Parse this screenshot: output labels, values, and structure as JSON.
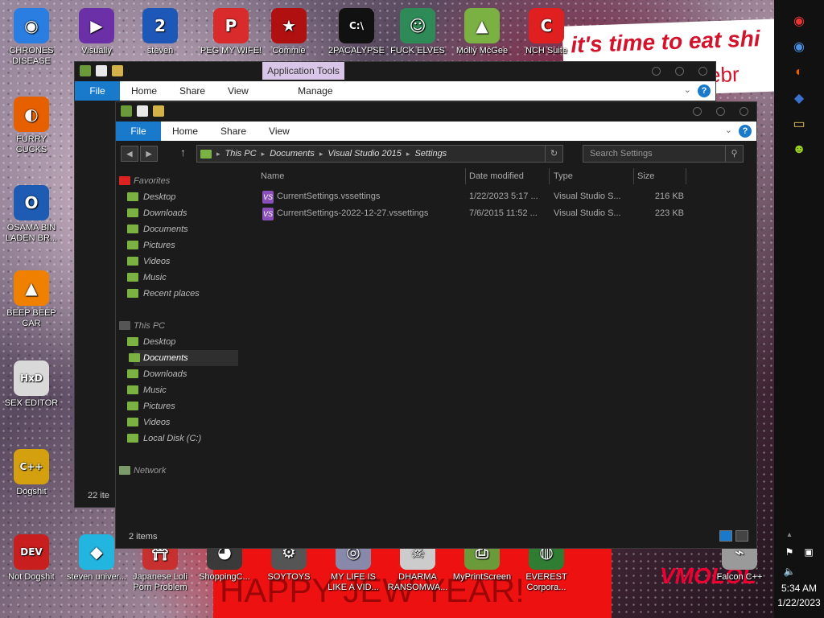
{
  "wallpaper": {
    "banner_line1": "it's time to eat shi",
    "banner_line2": "elebr",
    "bottom_text": "HAPPY JEW YEAR!",
    "vmo_text": "VMOLOL"
  },
  "desktop_icons": [
    {
      "label": "CHRONES DISEASE",
      "icon": "chrome-icon",
      "color": "#2a7de1",
      "glyph": "◉"
    },
    {
      "label": "Visually",
      "icon": "visual-studio-icon",
      "color": "#6b2fa8",
      "glyph": "▶"
    },
    {
      "label": "steven",
      "icon": "steven-icon",
      "color": "#1d57b8",
      "glyph": "2"
    },
    {
      "label": "PEG MY WIFE!",
      "icon": "peg-icon",
      "color": "#d92b2b",
      "glyph": "P"
    },
    {
      "label": "Commie",
      "icon": "commie-icon",
      "color": "#b01010",
      "glyph": "★"
    },
    {
      "label": "2PACALYPSE",
      "icon": "cmd-icon",
      "color": "#111111",
      "glyph": "C:\\"
    },
    {
      "label": "FUCK ELVES",
      "icon": "elf-icon",
      "color": "#2e8b57",
      "glyph": "☺"
    },
    {
      "label": "Molly McGee",
      "icon": "folder-icon",
      "color": "#7bb043",
      "glyph": "▲"
    },
    {
      "label": "NCH Suite",
      "icon": "nch-icon",
      "color": "#e02020",
      "glyph": "C"
    },
    {
      "label": "FURRY CUCKS",
      "icon": "firefox-icon",
      "color": "#e66000",
      "glyph": "◐"
    },
    {
      "label": "OSAMA BIN LADEN BR...",
      "icon": "obama-logo-icon",
      "color": "#1e5cb3",
      "glyph": "O"
    },
    {
      "label": "BEEP BEEP CAR",
      "icon": "vlc-icon",
      "color": "#f08000",
      "glyph": "▲"
    },
    {
      "label": "SEX EDITOR",
      "icon": "hxd-icon",
      "color": "#d9d9d9",
      "glyph": "HxD"
    },
    {
      "label": "Dogshit",
      "icon": "dogshit-icon",
      "color": "#d4a010",
      "glyph": "C++"
    },
    {
      "label": "Not Dogshit",
      "icon": "devcpp-icon",
      "color": "#c81e1e",
      "glyph": "DEV"
    },
    {
      "label": "steven univer...",
      "icon": "diamond-icon",
      "color": "#22b5e0",
      "glyph": "◆"
    },
    {
      "label": "Japanese Loli Porn Problem",
      "icon": "japanese-icon",
      "color": "#c83030",
      "glyph": "⛩"
    },
    {
      "label": "ShoppingC...",
      "icon": "shopping-icon",
      "color": "#3a3a3a",
      "glyph": "◕"
    },
    {
      "label": "SOYTOYS",
      "icon": "soytoys-icon",
      "color": "#555555",
      "glyph": "⚙"
    },
    {
      "label": "MY LIFE IS LIKE A VID...",
      "icon": "game-icon",
      "color": "#8888aa",
      "glyph": "◎"
    },
    {
      "label": "DHARMA RANSOMWA...",
      "icon": "skull-icon",
      "color": "#cccccc",
      "glyph": "☠"
    },
    {
      "label": "MyPrintScreen",
      "icon": "printscreen-icon",
      "color": "#6a9a3a",
      "glyph": "⎙"
    },
    {
      "label": "EVEREST Corpora...",
      "icon": "everest-icon",
      "color": "#2e7d32",
      "glyph": "◍"
    },
    {
      "label": "Falcon C++",
      "icon": "falcon-icon",
      "color": "#9a9a9a",
      "glyph": "⌁"
    }
  ],
  "taskbar": {
    "time": "5:34 AM",
    "date": "1/22/2023",
    "pinned": [
      {
        "name": "chrome-colorful-icon",
        "glyph": "◉",
        "color": "#e33"
      },
      {
        "name": "chrome-icon",
        "glyph": "◉",
        "color": "#4a90e2"
      },
      {
        "name": "firefox-icon",
        "glyph": "◐",
        "color": "#e66000"
      },
      {
        "name": "app-icon",
        "glyph": "◆",
        "color": "#3a70d0"
      },
      {
        "name": "explorer-icon",
        "glyph": "▭",
        "color": "#e0c060"
      },
      {
        "name": "game-icon",
        "glyph": "☻",
        "color": "#9ad020"
      }
    ]
  },
  "back_window": {
    "context_tab": "Application Tools",
    "tabs": [
      "File",
      "Home",
      "Share",
      "View",
      "Manage"
    ],
    "status": "22 ite"
  },
  "explorer": {
    "tabs": [
      "File",
      "Home",
      "Share",
      "View"
    ],
    "breadcrumb": [
      "This PC",
      "Documents",
      "Visual Studio 2015",
      "Settings"
    ],
    "search_placeholder": "Search Settings",
    "nav": {
      "favorites_label": "Favorites",
      "favorites": [
        "Desktop",
        "Downloads",
        "Documents",
        "Pictures",
        "Videos",
        "Music",
        "Recent places"
      ],
      "thispc_label": "This PC",
      "thispc": [
        "Desktop",
        "Documents",
        "Downloads",
        "Music",
        "Pictures",
        "Videos",
        "Local Disk (C:)"
      ],
      "network_label": "Network"
    },
    "columns": [
      "Name",
      "Date modified",
      "Type",
      "Size"
    ],
    "files": [
      {
        "name": "CurrentSettings.vssettings",
        "date": "1/22/2023 5:17 ...",
        "type": "Visual Studio S...",
        "size": "216 KB"
      },
      {
        "name": "CurrentSettings-2022-12-27.vssettings",
        "date": "7/6/2015 11:52 ...",
        "type": "Visual Studio S...",
        "size": "223 KB"
      }
    ],
    "status": "2 items"
  }
}
